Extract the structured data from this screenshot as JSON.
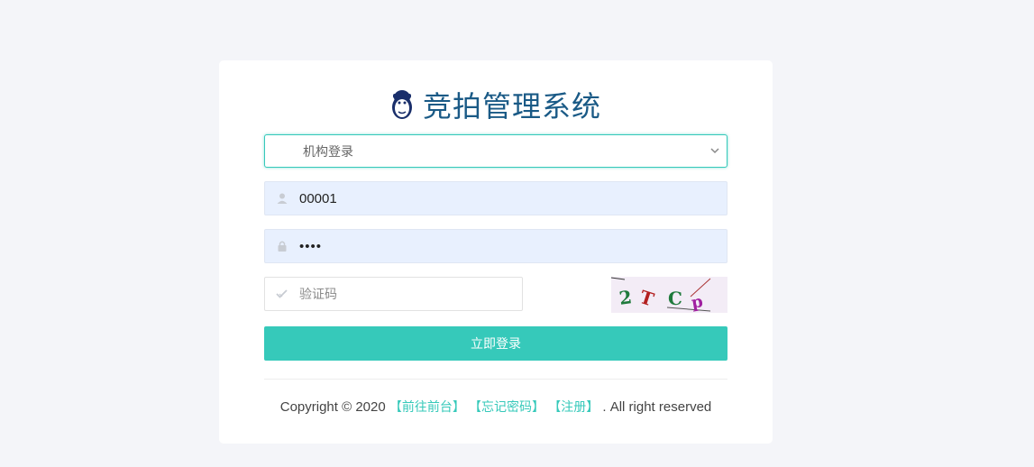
{
  "header": {
    "title": "竞拍管理系统",
    "logo_icon": "monkey-logo-icon"
  },
  "form": {
    "login_type": {
      "selected": "机构登录",
      "icon": "chevron-down-icon"
    },
    "username": {
      "value": "00001",
      "icon": "user-icon"
    },
    "password": {
      "masked_value": "••••",
      "icon": "lock-icon"
    },
    "captcha": {
      "placeholder": "验证码",
      "icon": "check-icon",
      "image_text": "2TCp"
    },
    "submit_label": "立即登录"
  },
  "footer": {
    "copyright": "Copyright © 2020",
    "links": [
      "【前往前台】",
      "【忘记密码】",
      "【注册】"
    ],
    "suffix": ". All right reserved"
  },
  "colors": {
    "accent": "#36c9ba",
    "title": "#1a5a86",
    "input_bg": "#e8f0fe",
    "page_bg": "#f4f5f9"
  }
}
